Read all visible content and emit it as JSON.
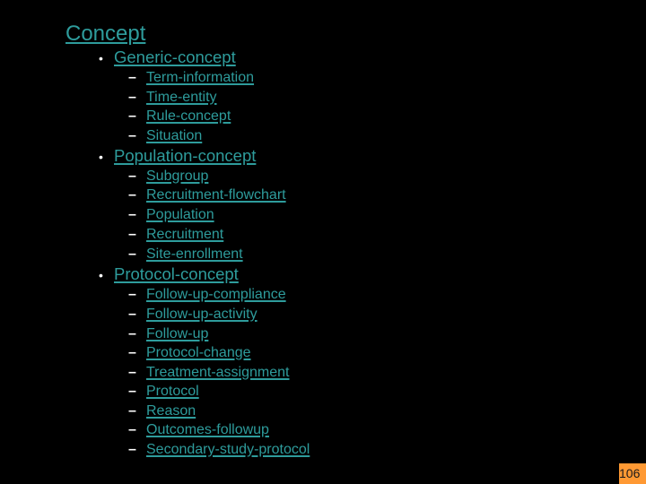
{
  "slide": {
    "title": "Concept",
    "sections": [
      {
        "label": "Generic-concept",
        "items": [
          "Term-information",
          "Time-entity",
          "Rule-concept",
          "Situation"
        ]
      },
      {
        "label": "Population-concept",
        "items": [
          "Subgroup",
          "Recruitment-flowchart",
          "Population",
          "Recruitment",
          "Site-enrollment"
        ]
      },
      {
        "label": "Protocol-concept",
        "items": [
          "Follow-up-compliance",
          "Follow-up-activity",
          "Follow-up",
          "Protocol-change",
          "Treatment-assignment",
          "Protocol",
          "Reason",
          "Outcomes-followup",
          "Secondary-study-protocol"
        ]
      }
    ],
    "bullet_glyph": "•",
    "dash_glyph": "–",
    "page_number": "106"
  },
  "colors": {
    "background": "#000000",
    "link": "#2E9C9C",
    "bullet": "#FFFFFF",
    "page_number_bg": "#FF9933",
    "page_number_text": "#1A1A1A"
  }
}
